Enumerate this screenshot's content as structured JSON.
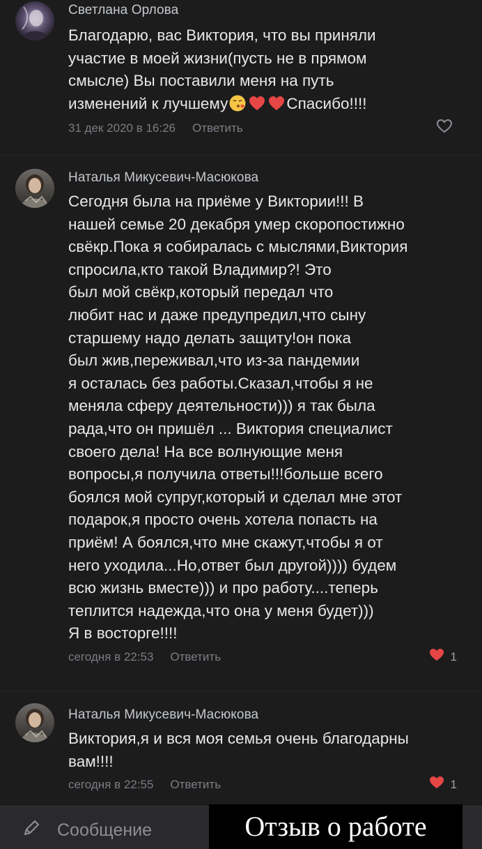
{
  "comments": [
    {
      "author": "Светлана Орлова",
      "text_before_emoji": "Благодарю, вас Виктория, что вы приняли\nучастие  в моей жизни(пусть не в прямом\nсмысле) Вы поставили  меня на путь\nизменений к лучшему",
      "text_after_emoji": "Спасибо!!!!",
      "emojis": [
        "kiss-face",
        "heart",
        "heart"
      ],
      "date": "31 дек 2020 в 16:26",
      "reply_label": "Ответить",
      "likes": ""
    },
    {
      "author": "Наталья Микусевич-Масюкова",
      "text": "Сегодня была на приёме у Виктории!!! В\nнашей семье 20 декабря умер скоропостижно\nсвёкр.Пока я собиралась с мыслями,Виктория\nспросила,кто такой Владимир?! Это\nбыл мой свёкр,который передал что\nлюбит нас и даже предупредил,что сыну\nстаршему надо делать защиту!он пока\nбыл жив,переживал,что из-за пандемии\nя осталась без работы.Сказал,чтобы я не\nменяла сферу деятельности))) я так была\nрада,что он пришёл ... Виктория специалист\nсвоего дела! На все волнующие меня\nвопросы,я получила ответы!!!больше всего\nбоялся мой супруг,который и сделал мне этот\nподарок,я просто очень хотела попасть на\nприём! А боялся,что мне скажут,чтобы я от\nнего уходила...Но,ответ был другой)))) будем\nвсю жизнь вместе))) и про работу....теперь\nтеплится надежда,что она у меня будет)))\nЯ в восторге!!!!",
      "date": "сегодня в 22:53",
      "reply_label": "Ответить",
      "likes": "1"
    },
    {
      "author": "Наталья Микусевич-Масюкова",
      "text": "Виктория,я и вся моя семья очень благодарны\nвам!!!!",
      "date": "сегодня в 22:55",
      "reply_label": "Ответить",
      "likes": "1"
    }
  ],
  "compose": {
    "placeholder": "Сообщение",
    "icon": "pencil-icon"
  },
  "overlay": {
    "label": "Отзыв о работе"
  },
  "colors": {
    "background": "#1c1c1d",
    "heart": "#e64646",
    "meta": "#797c82",
    "author": "#c4c8cc"
  }
}
